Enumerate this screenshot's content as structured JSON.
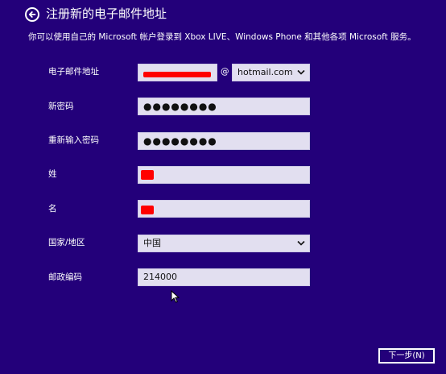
{
  "header": {
    "title": "注册新的电子邮件地址",
    "back_icon": "back-arrow-circle-icon"
  },
  "subtitle": "你可以使用自己的 Microsoft 帐户登录到 Xbox LIVE、Windows Phone 和其他各项 Microsoft 服务。",
  "form": {
    "email": {
      "label": "电子邮件地址",
      "at": "@",
      "domain": "hotmail.com"
    },
    "new_password": {
      "label": "新密码",
      "value": "●●●●●●●●"
    },
    "confirm_password": {
      "label": "重新输入密码",
      "value": "●●●●●●●●"
    },
    "last_name": {
      "label": "姓"
    },
    "first_name": {
      "label": "名"
    },
    "country": {
      "label": "国家/地区",
      "value": "中国"
    },
    "postal_code": {
      "label": "邮政编码",
      "value": "214000"
    }
  },
  "footer": {
    "next_label": "下一步(N)"
  },
  "colors": {
    "background": "#23007a",
    "field": "#e2dff0",
    "redaction": "#ff0000",
    "text": "#ffffff"
  }
}
